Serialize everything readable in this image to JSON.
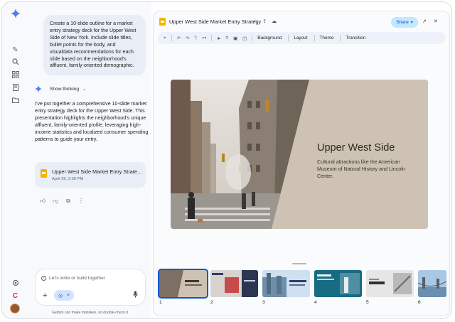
{
  "chat": {
    "user_prompt": "Create a 10-slide outline for a market entry strategy deck for the Upper West Side of New York. Include slide titles, bullet points for the body, and visualdata recommendations for each slide based on the neighborhood's affluent, family-oriented demographic.",
    "thinking_label": "Show thinking",
    "reply": "I've put together a comprehensive 10-slide market entry strategy deck for the Upper West Side. This presentation highlights the neighborhood's unique affluent, family-oriented profile, leveraging high-income statistics and localized consumer spending patterns to guide your entry.",
    "doc_card": {
      "title": "Upper West Side Market Entry Strate…",
      "date": "April 26, 2:26 PM"
    },
    "composer_placeholder": "Let's write or build together",
    "disclaimer": "Gemini can make mistakes, so double-check it"
  },
  "slides_app": {
    "title": "Upper West Side Market Entry Strategy",
    "share_label": "Share",
    "toolbar": [
      "Background",
      "Layout",
      "Theme",
      "Transition"
    ],
    "slide": {
      "heading": "Upper West Side",
      "body": "Cultural attractions like the American Museum of Natural History and Lincoln Center."
    },
    "thumbnails": [
      {
        "num": "1",
        "selected": true
      },
      {
        "num": "2",
        "selected": false
      },
      {
        "num": "3",
        "selected": false
      },
      {
        "num": "4",
        "selected": false
      },
      {
        "num": "5",
        "selected": false
      },
      {
        "num": "6",
        "selected": false
      }
    ]
  },
  "colors": {
    "accent": "#0b57d0",
    "share_bg": "#c2e7ff",
    "slide_bg": "#cdc2b3",
    "doc_icon": "#f4b400"
  }
}
